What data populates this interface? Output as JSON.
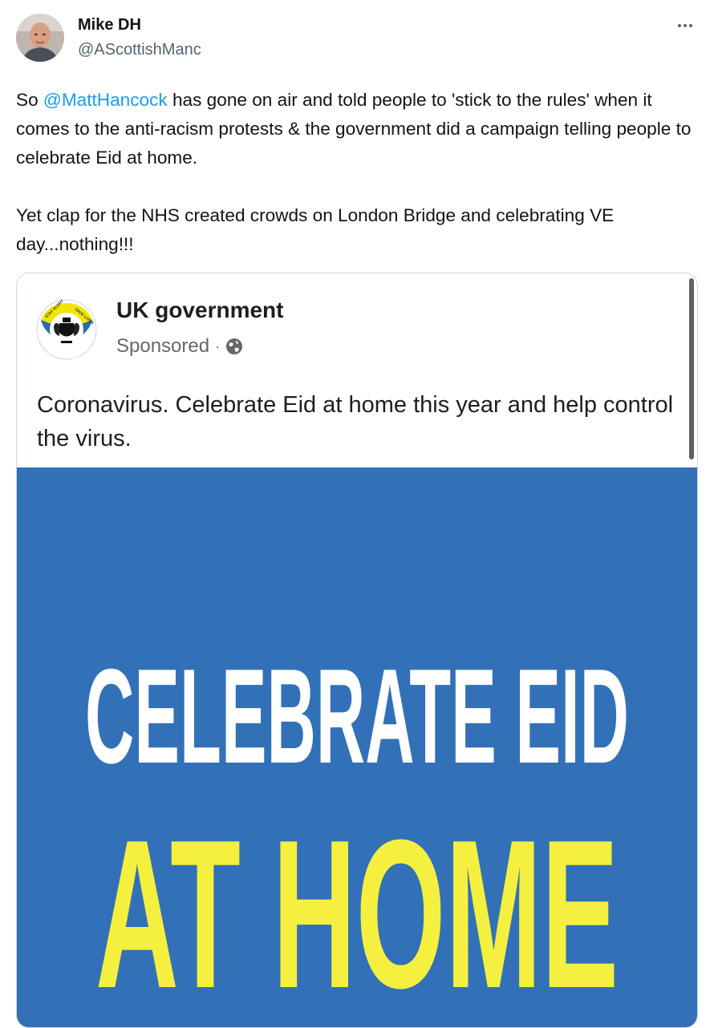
{
  "tweet": {
    "author": {
      "display_name": "Mike DH",
      "handle": "@AScottishManc"
    },
    "more_icon": "more-horizontal-icon",
    "text": {
      "p1_prefix": "So ",
      "mention": "@MattHancock",
      "p1_suffix": " has gone on air and told people to 'stick to the rules' when it comes to the anti-racism protests & the government did a campaign telling people to celebrate Eid at home.",
      "p2": "Yet clap for the NHS created crowds on London Bridge and celebrating VE day...nothing!!!"
    },
    "colors": {
      "link": "#1d9bf0",
      "secondary_text": "#536471"
    }
  },
  "embedded_post": {
    "page_name": "UK government",
    "sponsored_label": "Sponsored",
    "separator": "·",
    "audience_icon": "globe-icon",
    "text": "Coronavirus. Celebrate Eid at home this year and help control the virus.",
    "logo": {
      "ring_top_left": "STAY ALERT",
      "ring_top_right": "SAVE LIVES",
      "ring_bottom": "CONTROL THE VIRUS"
    },
    "poster": {
      "line1": "CELEBRATE EID",
      "line2": "AT HOME",
      "background_color": "#3271b7",
      "line1_color": "#ffffff",
      "line2_color": "#f5f03f"
    }
  }
}
